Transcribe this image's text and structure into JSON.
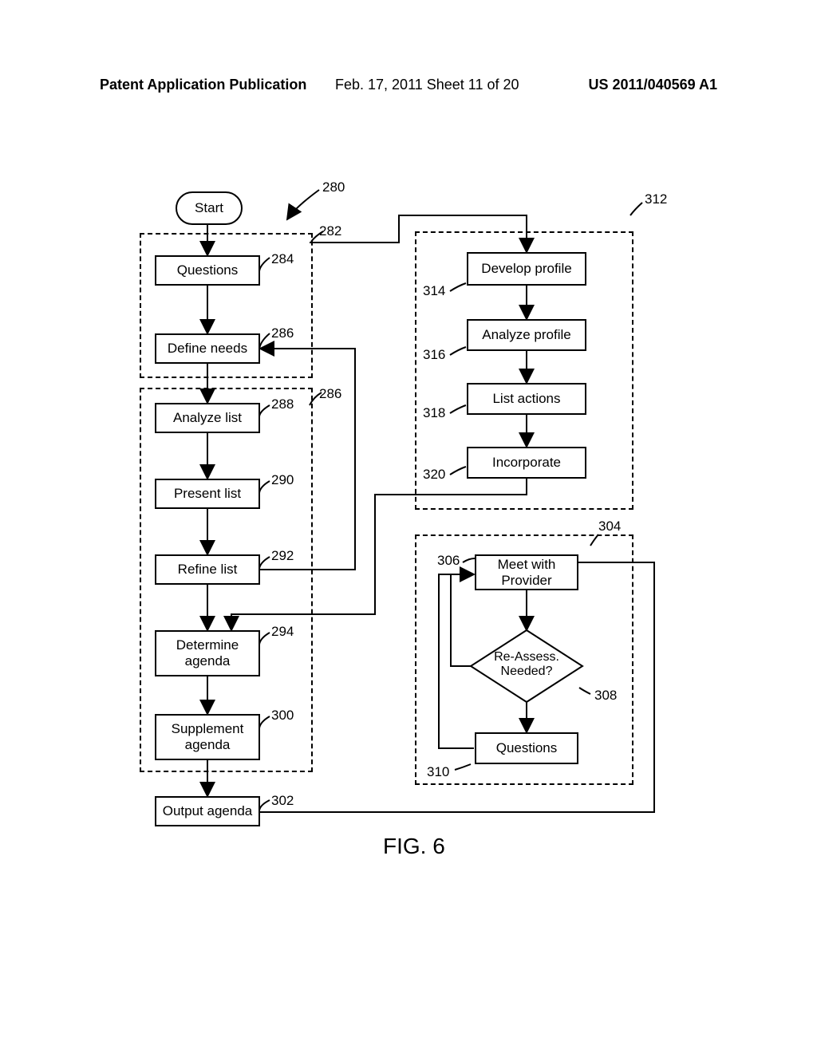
{
  "header": {
    "left": "Patent Application Publication",
    "center": "Feb. 17, 2011  Sheet 11 of 20",
    "right": "US 2011/040569 A1"
  },
  "nodes": {
    "start": "Start",
    "questions": "Questions",
    "define_needs": "Define needs",
    "analyze_list": "Analyze list",
    "present_list": "Present list",
    "refine_list": "Refine list",
    "determine_agenda": "Determine\nagenda",
    "supplement_agenda": "Supplement\nagenda",
    "output_agenda": "Output agenda",
    "develop_profile": "Develop profile",
    "analyze_profile": "Analyze profile",
    "list_actions": "List actions",
    "incorporate": "Incorporate",
    "meet_provider": "Meet with\nProvider",
    "reassess": "Re-Assess.\nNeeded?",
    "questions2": "Questions"
  },
  "refs": {
    "r280": "280",
    "r282": "282",
    "r284": "284",
    "r286a": "286",
    "r286b": "286",
    "r288": "288",
    "r290": "290",
    "r292": "292",
    "r294": "294",
    "r300": "300",
    "r302": "302",
    "r304": "304",
    "r306": "306",
    "r308": "308",
    "r310": "310",
    "r312": "312",
    "r314": "314",
    "r316": "316",
    "r318": "318",
    "r320": "320"
  },
  "figure_title": "FIG. 6"
}
